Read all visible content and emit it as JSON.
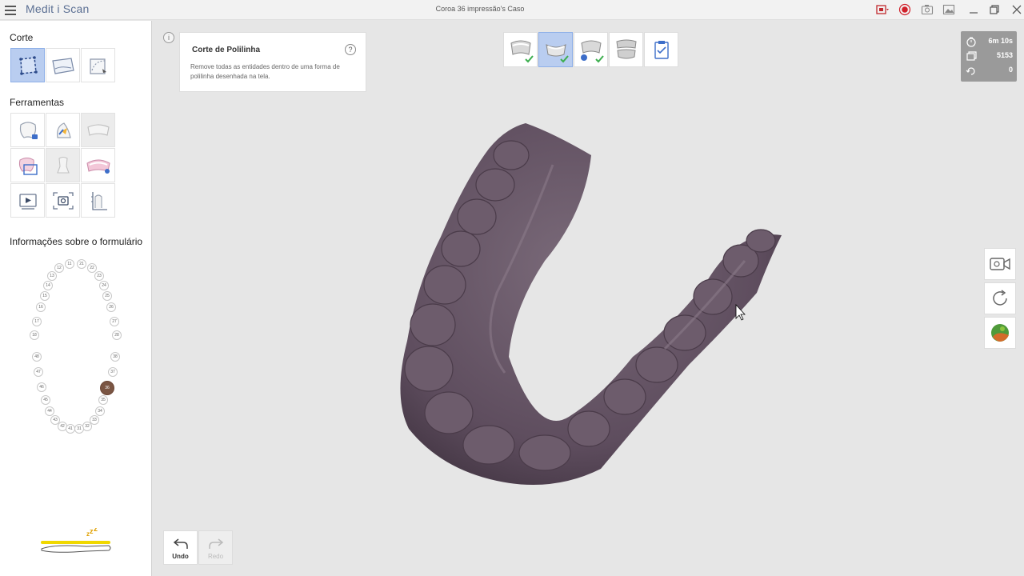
{
  "app": {
    "title": "Medit i Scan",
    "document_title": "Coroa 36 impressão's Caso"
  },
  "sidebar": {
    "cut_section_title": "Corte",
    "tools_section_title": "Ferramentas",
    "form_info_title": "Informações sobre o formulário"
  },
  "info_card": {
    "title": "Corte de Polilinha",
    "description": "Remove todas as entidades dentro de uma forma de polilinha desenhada na tela.",
    "help_symbol": "?",
    "info_symbol": "i"
  },
  "stats": {
    "time": "6m 10s",
    "count": "5153",
    "rotations": "0"
  },
  "tooth_chart": {
    "selected_tooth": "36"
  },
  "actions": {
    "undo_label": "Undo",
    "redo_label": "Redo"
  },
  "colors": {
    "accent": "#b9cdf0",
    "model": "#5e4d5e",
    "record": "#d0202a",
    "battery": "#f0d800"
  }
}
